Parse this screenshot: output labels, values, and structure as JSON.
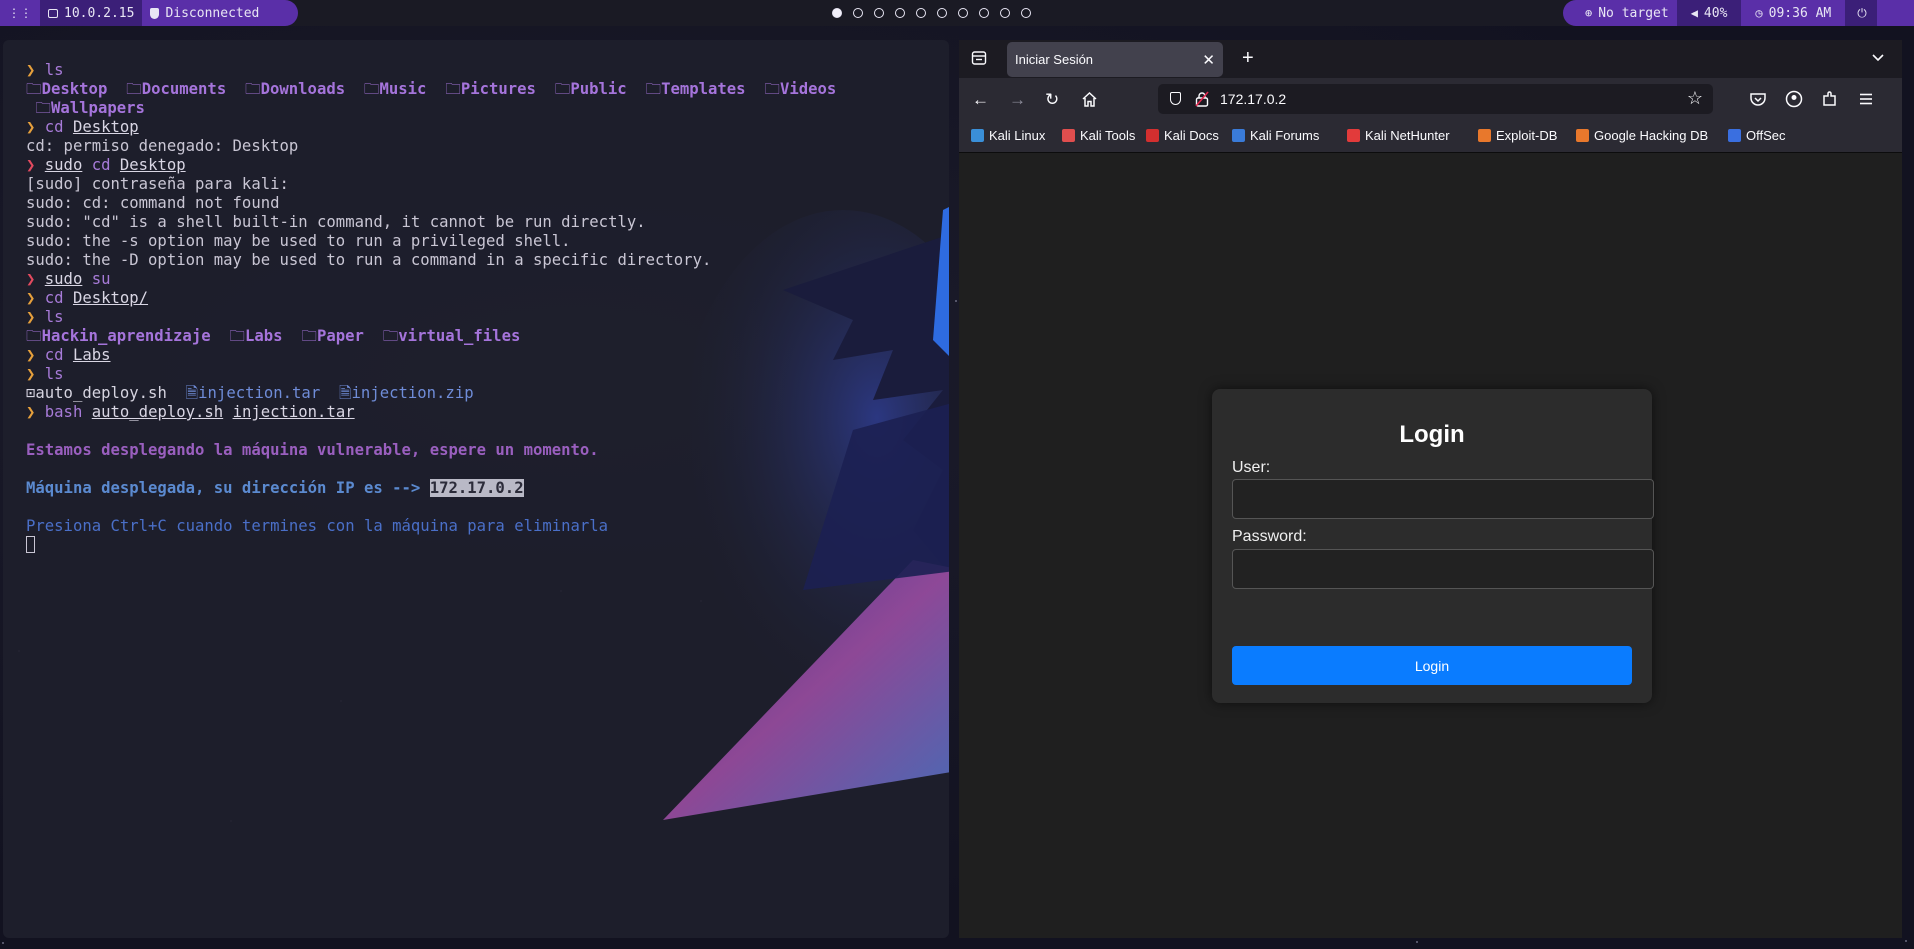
{
  "topbar": {
    "ip": "10.0.2.15",
    "vpn_status": "Disconnected",
    "workspaces": [
      true,
      false,
      false,
      false,
      false,
      false,
      false,
      false,
      false,
      false
    ],
    "target": "No target",
    "volume": "40%",
    "time": "09:36 AM"
  },
  "terminal": {
    "lines": [
      {
        "t": "cmd",
        "parts": [
          [
            "prompt-y",
            "❯ "
          ],
          [
            "cmd",
            "ls"
          ]
        ]
      },
      {
        "t": "ls",
        "parts": [
          [
            "dir",
            "Desktop"
          ],
          [
            "dir",
            "Documents"
          ],
          [
            "dir",
            "Downloads"
          ],
          [
            "dir",
            "Music"
          ],
          [
            "dir",
            "Pictures"
          ],
          [
            "dir",
            "Public"
          ],
          [
            "dir",
            "Templates"
          ],
          [
            "dir",
            "Videos"
          ]
        ]
      },
      {
        "t": "ls",
        "indent": true,
        "parts": [
          [
            "dir",
            "Wallpapers"
          ]
        ]
      },
      {
        "t": "cmd",
        "parts": [
          [
            "prompt-y",
            "❯ "
          ],
          [
            "cmd",
            "cd "
          ],
          [
            "ul",
            "Desktop"
          ]
        ]
      },
      {
        "t": "out",
        "text": "cd: permiso denegado: Desktop"
      },
      {
        "t": "cmd",
        "parts": [
          [
            "prompt-r",
            "❯ "
          ],
          [
            "ulcmd",
            "sudo"
          ],
          [
            "cmd",
            " cd "
          ],
          [
            "ul",
            "Desktop"
          ]
        ]
      },
      {
        "t": "out",
        "text": "[sudo] contraseña para kali:"
      },
      {
        "t": "out",
        "text": "sudo: cd: command not found"
      },
      {
        "t": "out",
        "text": "sudo: \"cd\" is a shell built-in command, it cannot be run directly."
      },
      {
        "t": "out",
        "text": "sudo: the -s option may be used to run a privileged shell."
      },
      {
        "t": "out",
        "text": "sudo: the -D option may be used to run a command in a specific directory."
      },
      {
        "t": "cmd",
        "parts": [
          [
            "prompt-r",
            "❯ "
          ],
          [
            "ulcmd",
            "sudo"
          ],
          [
            "cmd",
            " su"
          ]
        ]
      },
      {
        "t": "cmd",
        "parts": [
          [
            "prompt-y",
            "❯ "
          ],
          [
            "cmd",
            "cd "
          ],
          [
            "ul",
            "Desktop/"
          ]
        ]
      },
      {
        "t": "cmd",
        "parts": [
          [
            "prompt-y",
            "❯ "
          ],
          [
            "cmd",
            "ls"
          ]
        ]
      },
      {
        "t": "ls",
        "parts": [
          [
            "dir",
            "Hackin_aprendizaje"
          ],
          [
            "dir",
            "Labs"
          ],
          [
            "dir",
            "Paper"
          ],
          [
            "dir",
            "virtual_files"
          ]
        ]
      },
      {
        "t": "cmd",
        "parts": [
          [
            "prompt-y",
            "❯ "
          ],
          [
            "cmd",
            "cd "
          ],
          [
            "ul",
            "Labs"
          ]
        ]
      },
      {
        "t": "cmd",
        "parts": [
          [
            "prompt-y",
            "❯ "
          ],
          [
            "cmd",
            "ls"
          ]
        ]
      },
      {
        "t": "ls",
        "parts": [
          [
            "file",
            "auto_deploy.sh"
          ],
          [
            "arch",
            "injection.tar"
          ],
          [
            "arch",
            "injection.zip"
          ]
        ]
      },
      {
        "t": "cmd",
        "parts": [
          [
            "prompt-y",
            "❯ "
          ],
          [
            "cmd",
            "bash "
          ],
          [
            "ul",
            "auto_deploy.sh"
          ],
          [
            "cmd",
            " "
          ],
          [
            "ul",
            "injection.tar"
          ]
        ]
      },
      {
        "t": "blank"
      },
      {
        "t": "msg",
        "cls": "msg-purple",
        "text": "Estamos desplegando la máquina vulnerable, espere un momento."
      },
      {
        "t": "blank"
      },
      {
        "t": "msgip",
        "text": "Máquina desplegada, su dirección IP es --> ",
        "ip": "172.17.0.2"
      },
      {
        "t": "blank"
      },
      {
        "t": "msg",
        "cls": "msg-blue2",
        "text": "Presiona Ctrl+C cuando termines con la máquina para eliminarla"
      },
      {
        "t": "cursor"
      }
    ]
  },
  "browser": {
    "tab_title": "Iniciar Sesión",
    "url": "172.17.0.2",
    "bookmarks": [
      {
        "label": "Kali Linux",
        "color": "#3a8fd8",
        "icon": "kali-dragon-icon"
      },
      {
        "label": "Kali Tools",
        "color": "#e04e4e",
        "icon": "kali-tools-icon"
      },
      {
        "label": "Kali Docs",
        "color": "#d32f2f",
        "icon": "kali-docs-icon"
      },
      {
        "label": "Kali Forums",
        "color": "#3a7bd8",
        "icon": "kali-forums-icon"
      },
      {
        "label": "Kali NetHunter",
        "color": "#e23b3b",
        "icon": "nethunter-icon"
      },
      {
        "label": "Exploit-DB",
        "color": "#e8782c",
        "icon": "exploit-db-icon"
      },
      {
        "label": "Google Hacking DB",
        "color": "#e8782c",
        "icon": "ghdb-icon"
      },
      {
        "label": "OffSec",
        "color": "#3a6fe0",
        "icon": "offsec-icon"
      }
    ],
    "login": {
      "title": "Login",
      "user_label": "User:",
      "password_label": "Password:",
      "user_value": "",
      "password_value": "",
      "button": "Login"
    }
  }
}
